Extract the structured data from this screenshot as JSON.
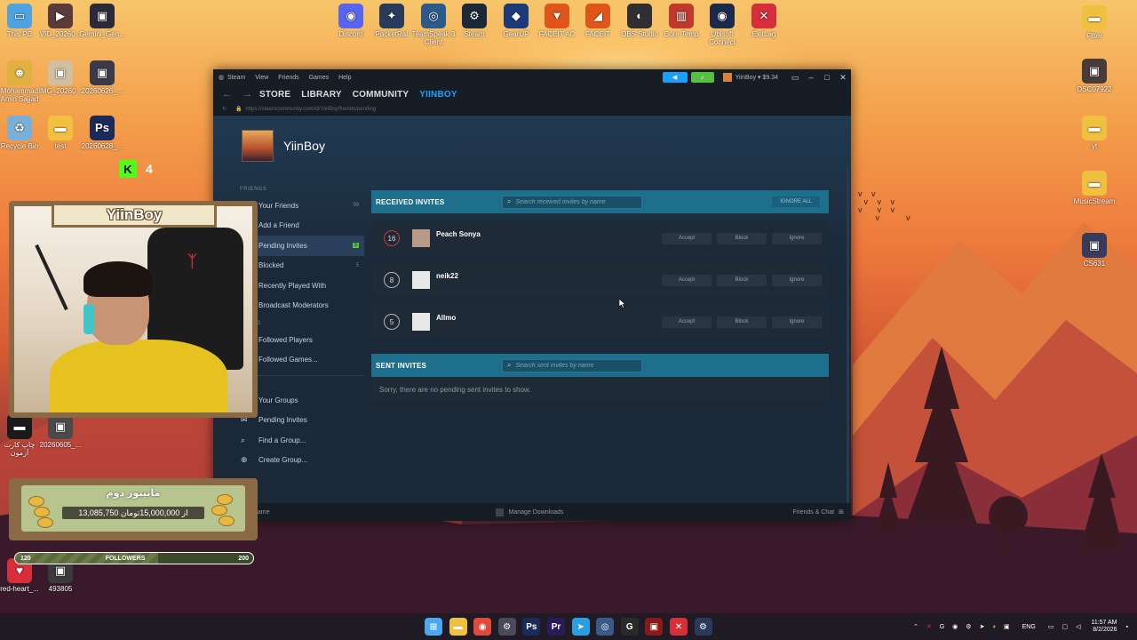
{
  "desktop": {
    "top_icons": [
      {
        "label": "Discord",
        "color": "#5865f2",
        "glyph": "◉"
      },
      {
        "label": "PacketRat",
        "color": "#2a3a5a",
        "glyph": "✦"
      },
      {
        "label": "TeamSpeak 3 Client",
        "color": "#2d5a8c",
        "glyph": "◎"
      },
      {
        "label": "Steam",
        "color": "#1b2838",
        "glyph": "⚙"
      },
      {
        "label": "GearUP",
        "color": "#1a3a7a",
        "glyph": "◆"
      },
      {
        "label": "FACEIT AC",
        "color": "#e0561a",
        "glyph": "▼"
      },
      {
        "label": "FACEIT",
        "color": "#e0561a",
        "glyph": "◢"
      },
      {
        "label": "OBS Studio",
        "color": "#302e31",
        "glyph": "◐"
      },
      {
        "label": "Core Temp",
        "color": "#c0392b",
        "glyph": "▥"
      },
      {
        "label": "Ubisoft Connect",
        "color": "#1a2a4a",
        "glyph": "◉"
      },
      {
        "label": "ExitLag",
        "color": "#d62e3a",
        "glyph": "✕"
      }
    ],
    "left_icons": [
      {
        "label": "This PC",
        "color": "#4fa3e0",
        "glyph": "▭"
      },
      {
        "label": "VID_20260...",
        "color": "#5a3a3a",
        "glyph": "▶"
      },
      {
        "label": "Gemini_Gen...",
        "color": "#2a2a3a",
        "glyph": "▣"
      },
      {
        "label": "Mohammad Amin Sajjad",
        "color": "#e0b040",
        "glyph": "☻"
      },
      {
        "label": "IMG_20260...",
        "color": "#d0c0a0",
        "glyph": "▣"
      },
      {
        "label": "20260626_...",
        "color": "#3a3a4a",
        "glyph": "▣"
      },
      {
        "label": "Recycle Bin",
        "color": "#7ab0d8",
        "glyph": "♻"
      },
      {
        "label": "test",
        "color": "#f0c040",
        "glyph": "▬"
      },
      {
        "label": "20260628_...",
        "color": "#1a2a5a",
        "glyph": "Ps"
      }
    ],
    "right_icons": [
      {
        "label": "Filter",
        "color": "#f0c040",
        "glyph": "▬"
      },
      {
        "label": "DSC07922",
        "color": "#4a3a3a",
        "glyph": "▣"
      },
      {
        "label": "yt",
        "color": "#f0c040",
        "glyph": "▬"
      },
      {
        "label": "MusicStream",
        "color": "#f0c040",
        "glyph": "▬"
      },
      {
        "label": "CS631",
        "color": "#3a3a5a",
        "glyph": "▣"
      }
    ],
    "bottom_left_icons": [
      {
        "label": "red-heart_...",
        "color": "#d62e3a",
        "glyph": "♥"
      },
      {
        "label": "493805",
        "color": "#3a3a3a",
        "glyph": "▣"
      },
      {
        "label": "چاپ کارت آزمون",
        "color": "#1a1a1a",
        "glyph": "▬"
      },
      {
        "label": "20260605_...",
        "color": "#4a4a4a",
        "glyph": "▣"
      }
    ]
  },
  "steam": {
    "titlebar": {
      "menu": [
        "Steam",
        "View",
        "Friends",
        "Games",
        "Help"
      ],
      "account": "YiinBoy ▾ $9.34"
    },
    "nav": {
      "links": [
        "STORE",
        "LIBRARY",
        "COMMUNITY",
        "YIINBOY"
      ]
    },
    "url": "https://steamcommunity.com/id/YiinBoy/friends/pending",
    "profile_name": "YiinBoy",
    "sidebar": {
      "friends_heading": "FRIENDS",
      "friends_items": [
        {
          "label": "Your Friends",
          "count": "99"
        },
        {
          "label": "Add a Friend",
          "count": ""
        },
        {
          "label": "Pending Invites",
          "count": "3"
        },
        {
          "label": "Blocked",
          "count": "5"
        },
        {
          "label": "Recently Played With",
          "count": ""
        },
        {
          "label": "Broadcast Moderators",
          "count": ""
        }
      ],
      "following_heading": "OWING",
      "following_items": [
        "Followed Players",
        "Followed Games..."
      ],
      "groups_items": [
        "Your Groups",
        "Pending Invites",
        "Find a Group...",
        "Create Group..."
      ]
    },
    "received": {
      "title": "RECEIVED INVITES",
      "search_placeholder": "Search received invites by name",
      "ignore_all": "IGNORE ALL",
      "invites": [
        {
          "level": "16",
          "name": "Peach Sonya",
          "accept": "Accept",
          "block": "Block",
          "ignore": "Ignore"
        },
        {
          "level": "8",
          "name": "neik22",
          "accept": "Accept",
          "block": "Block",
          "ignore": "Ignore"
        },
        {
          "level": "5",
          "name": "Allmo",
          "accept": "Accept",
          "block": "Block",
          "ignore": "Ignore"
        }
      ]
    },
    "sent": {
      "title": "SENT INVITES",
      "search_placeholder": "Search sent invites by name",
      "empty_text": "Sorry, there are no pending sent invites to show."
    },
    "statusbar": {
      "left": "name",
      "center": "Manage Downloads",
      "right": "Friends & Chat"
    }
  },
  "overlay": {
    "cam_name": "YiinBoy",
    "kick_count": "4",
    "donate_title": "مانیتور دوم",
    "donate_progress": "13,085,750 از 15,000,000تومان",
    "followers_label": "FOLLOWERS",
    "followers_current": "120",
    "followers_goal": "200"
  },
  "taskbar": {
    "apps": [
      {
        "name": "windows",
        "color": "#4aa8f0",
        "glyph": "⊞"
      },
      {
        "name": "file-explorer",
        "color": "#f0c040",
        "glyph": "▬"
      },
      {
        "name": "chrome",
        "color": "#e04a3a",
        "glyph": "◉"
      },
      {
        "name": "gear-app",
        "color": "#4a4a5a",
        "glyph": "⚙"
      },
      {
        "name": "photoshop",
        "color": "#1a2a5a",
        "glyph": "Ps"
      },
      {
        "name": "premiere",
        "color": "#2a1a5a",
        "glyph": "Pr"
      },
      {
        "name": "telegram",
        "color": "#2aa0e0",
        "glyph": "➤"
      },
      {
        "name": "teamspeak",
        "color": "#3a5a8a",
        "glyph": "◎"
      },
      {
        "name": "app-g",
        "color": "#2a2a2a",
        "glyph": "G"
      },
      {
        "name": "app-red",
        "color": "#8a1a1a",
        "glyph": "▣"
      },
      {
        "name": "exitlag",
        "color": "#d62e3a",
        "glyph": "✕"
      },
      {
        "name": "steam",
        "color": "#2a3a5a",
        "glyph": "⚙"
      }
    ],
    "tray_language": "ENG",
    "time": "11:57 AM",
    "date": "8/2/2026"
  }
}
